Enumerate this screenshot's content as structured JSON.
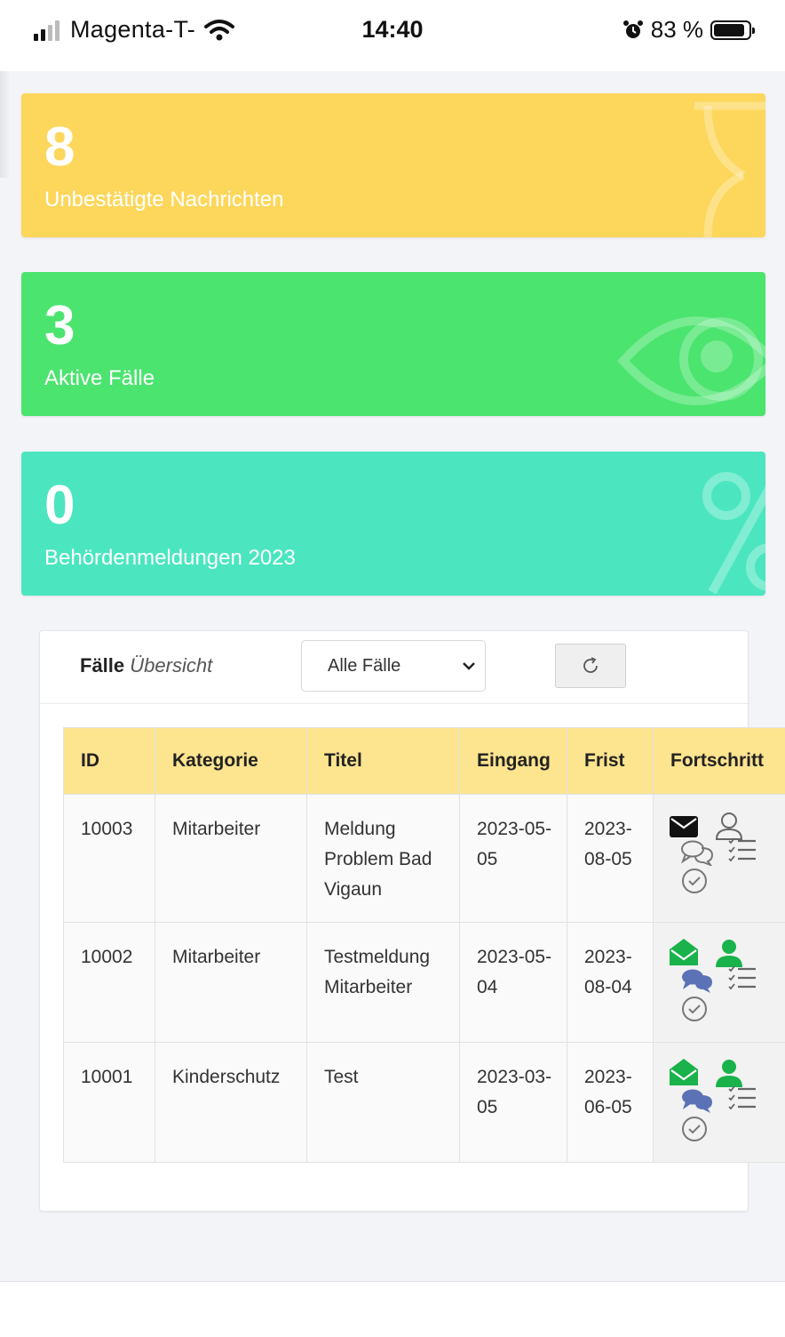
{
  "status_bar": {
    "carrier": "Magenta-T-",
    "time": "14:40",
    "battery": "83 %"
  },
  "stats": [
    {
      "value": "8",
      "label": "Unbestätigte Nachrichten",
      "color": "#fdd75c",
      "icon": "hourglass-icon"
    },
    {
      "value": "3",
      "label": "Aktive Fälle",
      "color": "#4be46f",
      "icon": "eye-icon"
    },
    {
      "value": "0",
      "label": "Behördenmeldungen 2023",
      "color": "#4be6c0",
      "icon": "percent-icon"
    }
  ],
  "cases": {
    "title": "Fälle",
    "subtitle": "Übersicht",
    "filter": "Alle Fälle",
    "columns": [
      "ID",
      "Kategorie",
      "Titel",
      "Eingang",
      "Frist",
      "Fortschritt"
    ],
    "rows": [
      {
        "id": "10003",
        "category": "Mitarbeiter",
        "title": "Meldung Problem Bad Vigaun",
        "received": "2023-05-05",
        "deadline": "2023-08-05",
        "progress": [
          "envelope-closed-icon",
          "user-outline-icon",
          "chat-outline-icon",
          "checklist-icon",
          "check-circle-icon"
        ]
      },
      {
        "id": "10002",
        "category": "Mitarbeiter",
        "title": "Testmeldung Mitarbeiter",
        "received": "2023-05-04",
        "deadline": "2023-08-04",
        "progress": [
          "envelope-open-icon",
          "user-filled-icon",
          "chat-filled-icon",
          "checklist-icon",
          "check-circle-icon"
        ]
      },
      {
        "id": "10001",
        "category": "Kinderschutz",
        "title": "Test",
        "received": "2023-03-05",
        "deadline": "2023-06-05",
        "progress": [
          "envelope-open-icon",
          "user-filled-icon",
          "chat-filled-icon",
          "checklist-icon",
          "check-circle-icon"
        ]
      }
    ]
  },
  "colors": {
    "accent_green": "#19b24b",
    "chat_blue": "#5b73b6",
    "header_yellow": "#fde48f"
  }
}
